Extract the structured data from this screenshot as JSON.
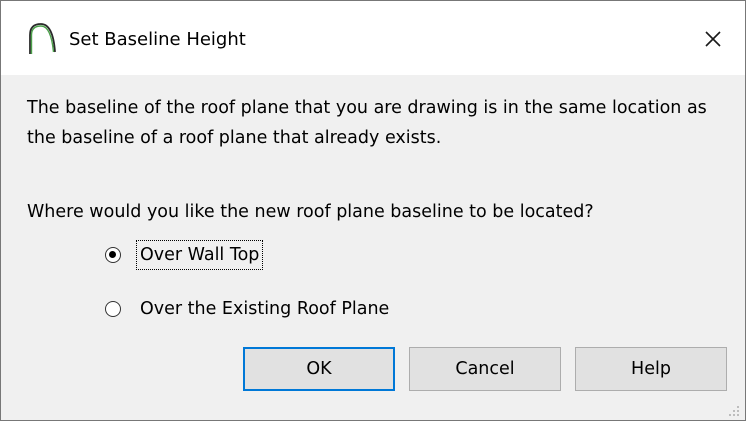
{
  "dialog": {
    "title": "Set Baseline Height",
    "icons": {
      "title": "roof-arc-icon",
      "close": "close-icon",
      "grip": "resize-grip-icon"
    },
    "message": "The baseline of the roof plane that you are drawing is in the same location as the baseline of a roof plane that already exists.",
    "question": "Where would you like the new roof plane baseline to be located?",
    "options": [
      {
        "label": "Over Wall Top",
        "selected": true
      },
      {
        "label": "Over the Existing Roof Plane",
        "selected": false
      }
    ],
    "buttons": {
      "ok": "OK",
      "cancel": "Cancel",
      "help": "Help"
    },
    "colors": {
      "default_button_border": "#0078d7",
      "title_icon": "#4ba04a"
    }
  }
}
